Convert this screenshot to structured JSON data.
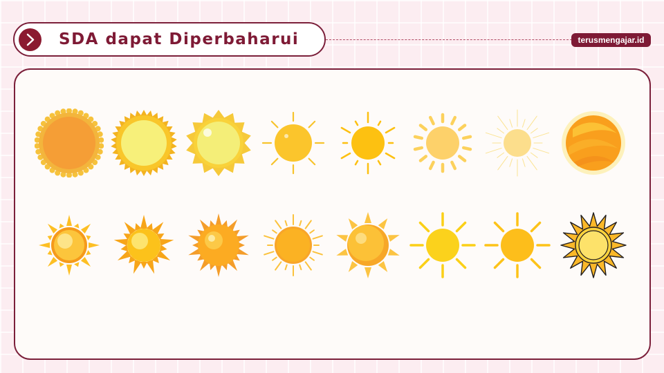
{
  "header": {
    "title": "SDA dapat Diperbaharui",
    "brand": "terusmengajar.id",
    "arrow_icon": "chevron-right-icon"
  },
  "colors": {
    "accent": "#7e1a35",
    "background": "#fcedf1",
    "panel": "#fefbf9"
  },
  "gallery": {
    "rows": [
      [
        "sun-icon-1",
        "sun-icon-2",
        "sun-icon-3",
        "sun-icon-4",
        "sun-icon-5",
        "sun-icon-6",
        "sun-icon-7",
        "sun-icon-8"
      ],
      [
        "sun-icon-9",
        "sun-icon-10",
        "sun-icon-11",
        "sun-icon-12",
        "sun-icon-13",
        "sun-icon-14",
        "sun-icon-15",
        "sun-icon-16"
      ]
    ]
  }
}
